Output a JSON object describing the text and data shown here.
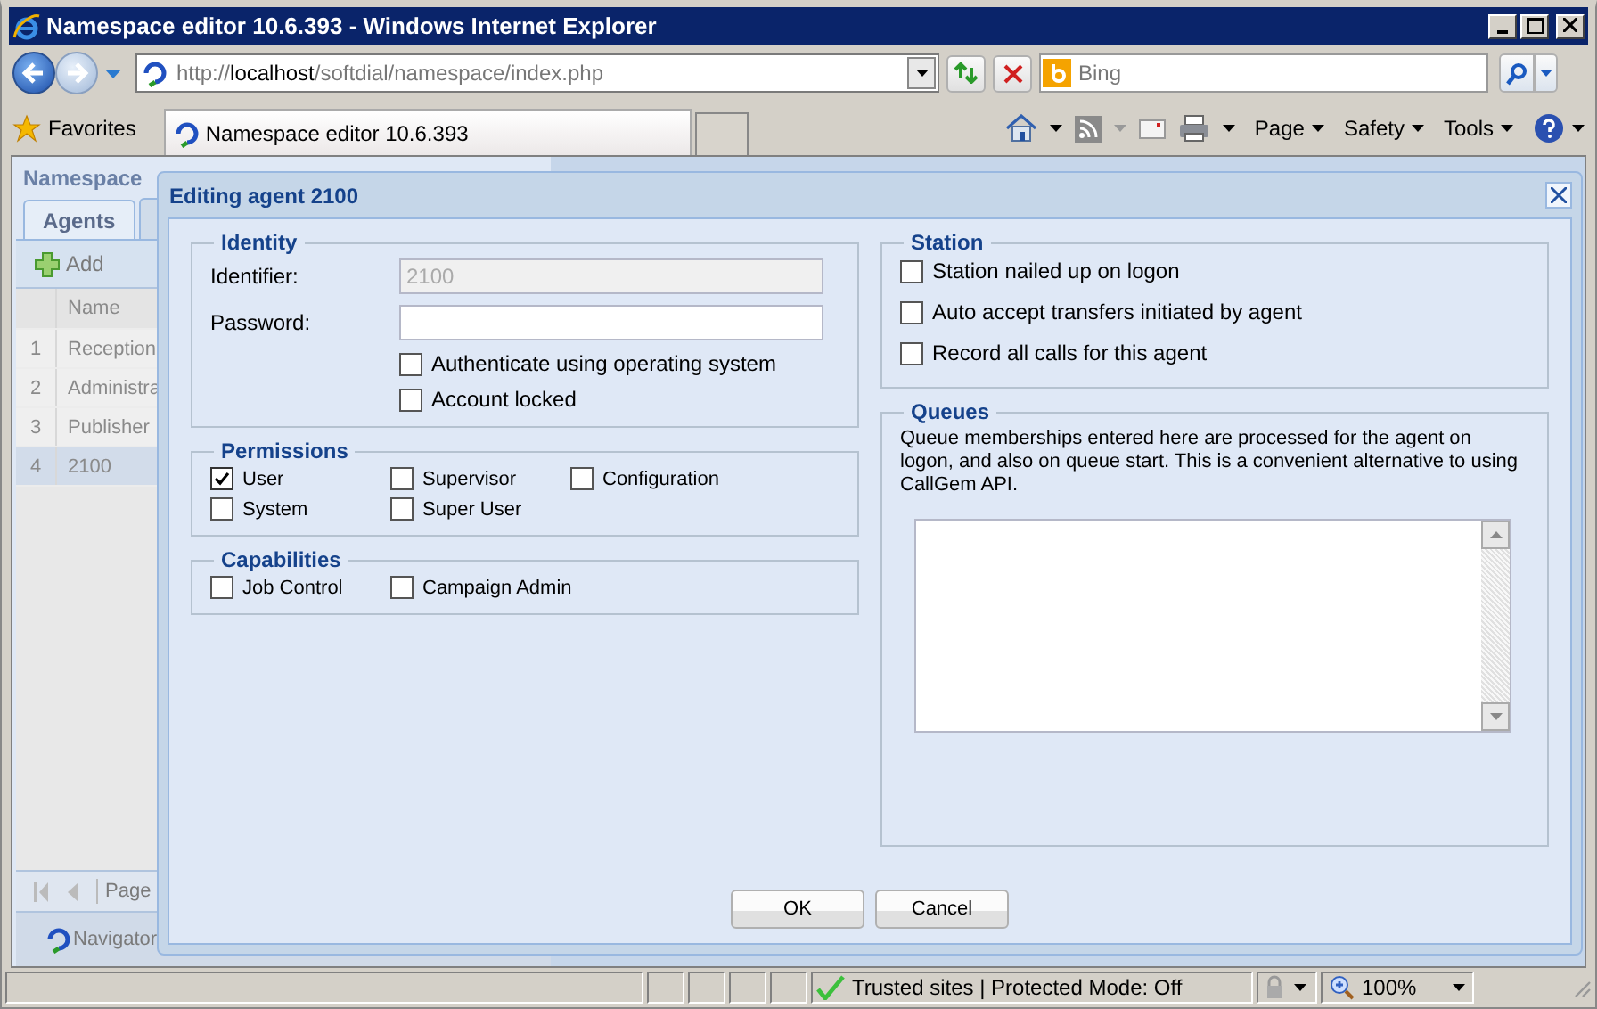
{
  "window": {
    "title": "Namespace editor 10.6.393 - Windows Internet Explorer"
  },
  "address_bar": {
    "url_prefix": "http://",
    "url_host": "localhost",
    "url_path": "/softdial/namespace/index.php"
  },
  "search": {
    "placeholder": "Bing"
  },
  "favorites": {
    "label": "Favorites"
  },
  "tab": {
    "title": "Namespace editor 10.6.393"
  },
  "command_menus": [
    "Page",
    "Safety",
    "Tools"
  ],
  "app": {
    "header": "Namespace",
    "tabs": [
      {
        "label": "Agents",
        "selected": true
      }
    ],
    "toolbar": {
      "add": "Add"
    },
    "grid": {
      "column": "Name",
      "rows": [
        {
          "number": "1",
          "name": "Reception",
          "selected": false
        },
        {
          "number": "2",
          "name": "Administra",
          "selected": false
        },
        {
          "number": "3",
          "name": "Publisher",
          "selected": false
        },
        {
          "number": "4",
          "name": "2100",
          "selected": true
        }
      ]
    },
    "pager": {
      "label": "Page"
    },
    "navigator": "Navigator"
  },
  "dialog": {
    "title": "Editing agent 2100",
    "identity": {
      "legend": "Identity",
      "identifier_label": "Identifier:",
      "identifier_value": "2100",
      "password_label": "Password:",
      "options": [
        {
          "label": "Authenticate using operating system",
          "checked": false
        },
        {
          "label": "Account locked",
          "checked": false
        }
      ]
    },
    "permissions": {
      "legend": "Permissions",
      "options": [
        {
          "label": "User",
          "checked": true
        },
        {
          "label": "Supervisor",
          "checked": false
        },
        {
          "label": "Configuration",
          "checked": false
        },
        {
          "label": "System",
          "checked": false
        },
        {
          "label": "Super User",
          "checked": false
        }
      ]
    },
    "capabilities": {
      "legend": "Capabilities",
      "options": [
        {
          "label": "Job Control",
          "checked": false
        },
        {
          "label": "Campaign Admin",
          "checked": false
        }
      ]
    },
    "station": {
      "legend": "Station",
      "options": [
        {
          "label": "Station nailed up on logon",
          "checked": false
        },
        {
          "label": "Auto accept transfers initiated by agent",
          "checked": false
        },
        {
          "label": "Record all calls for this agent",
          "checked": false
        }
      ]
    },
    "queues": {
      "legend": "Queues",
      "description": "Queue memberships entered here are processed for the agent on logon, and also on queue start. This is a convenient alternative to using CallGem API."
    },
    "buttons": [
      "OK",
      "Cancel"
    ]
  },
  "status_bar": {
    "zone": "Trusted sites | Protected Mode: Off",
    "zoom": "100%"
  }
}
